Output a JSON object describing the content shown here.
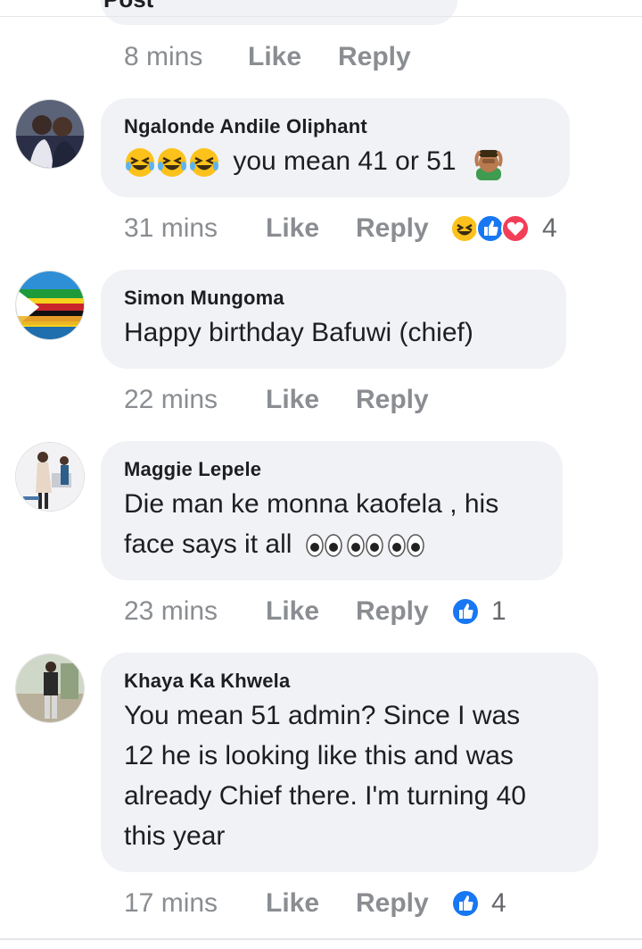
{
  "prev": {
    "title": "Post",
    "time": "8 mins",
    "like": "Like",
    "reply": "Reply"
  },
  "comments": [
    {
      "author": "Ngalonde Andile Oliphant",
      "text": "you mean 41 or 51",
      "time": "31 mins",
      "like": "Like",
      "reply": "Reply",
      "reactions": [
        "laugh",
        "like",
        "love"
      ],
      "reaction_count": "4"
    },
    {
      "author": "Simon Mungoma",
      "text": "Happy birthday Bafuwi (chief)",
      "time": "22 mins",
      "like": "Like",
      "reply": "Reply"
    },
    {
      "author": "Maggie Lepele",
      "text_line1": "Die man ke monna kaofela , his",
      "text_line2": "face says it all",
      "time": "23 mins",
      "like": "Like",
      "reply": "Reply",
      "reactions": [
        "like"
      ],
      "reaction_count": "1"
    },
    {
      "author": "Khaya Ka Khwela",
      "text_line1": "You mean 51 admin? Since I was",
      "text_line2": "12 he is looking like this and was",
      "text_line3": "already Chief there. I'm turning 40",
      "text_line4": "this year",
      "time": "17 mins",
      "like": "Like",
      "reply": "Reply",
      "reactions": [
        "like"
      ],
      "reaction_count": "4"
    }
  ],
  "colors": {
    "bubble": "#f0f2f5",
    "meta": "#8a8d91",
    "like_blue": "#1877f2",
    "love_red": "#f33e58",
    "emoji_yellow": "#fcc21b"
  }
}
